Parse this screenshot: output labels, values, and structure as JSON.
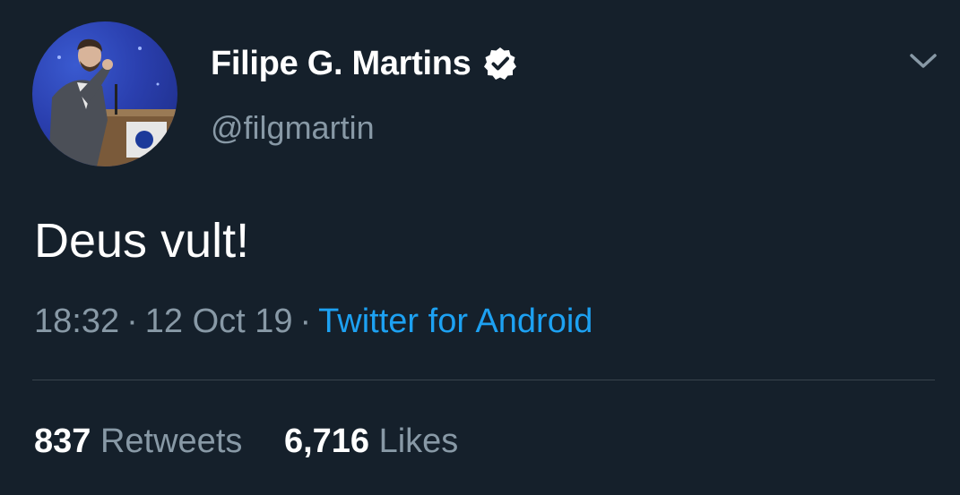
{
  "tweet": {
    "author": {
      "display_name": "Filipe G. Martins",
      "username": "@filgmartin",
      "verified": true,
      "avatar_icon": "avatar-photo"
    },
    "text": "Deus vult!",
    "meta": {
      "time": "18:32",
      "date": "12 Oct 19",
      "separator": "·",
      "source": "Twitter for Android"
    },
    "stats": {
      "retweets_count": "837",
      "retweets_label": "Retweets",
      "likes_count": "6,716",
      "likes_label": "Likes"
    },
    "colors": {
      "background": "#15202b",
      "primary_text": "#ffffff",
      "secondary_text": "#8899a6",
      "accent": "#1da1f2",
      "divider": "#38444d"
    },
    "icons": {
      "verified": "verified-badge-icon",
      "menu": "chevron-down-icon"
    }
  }
}
